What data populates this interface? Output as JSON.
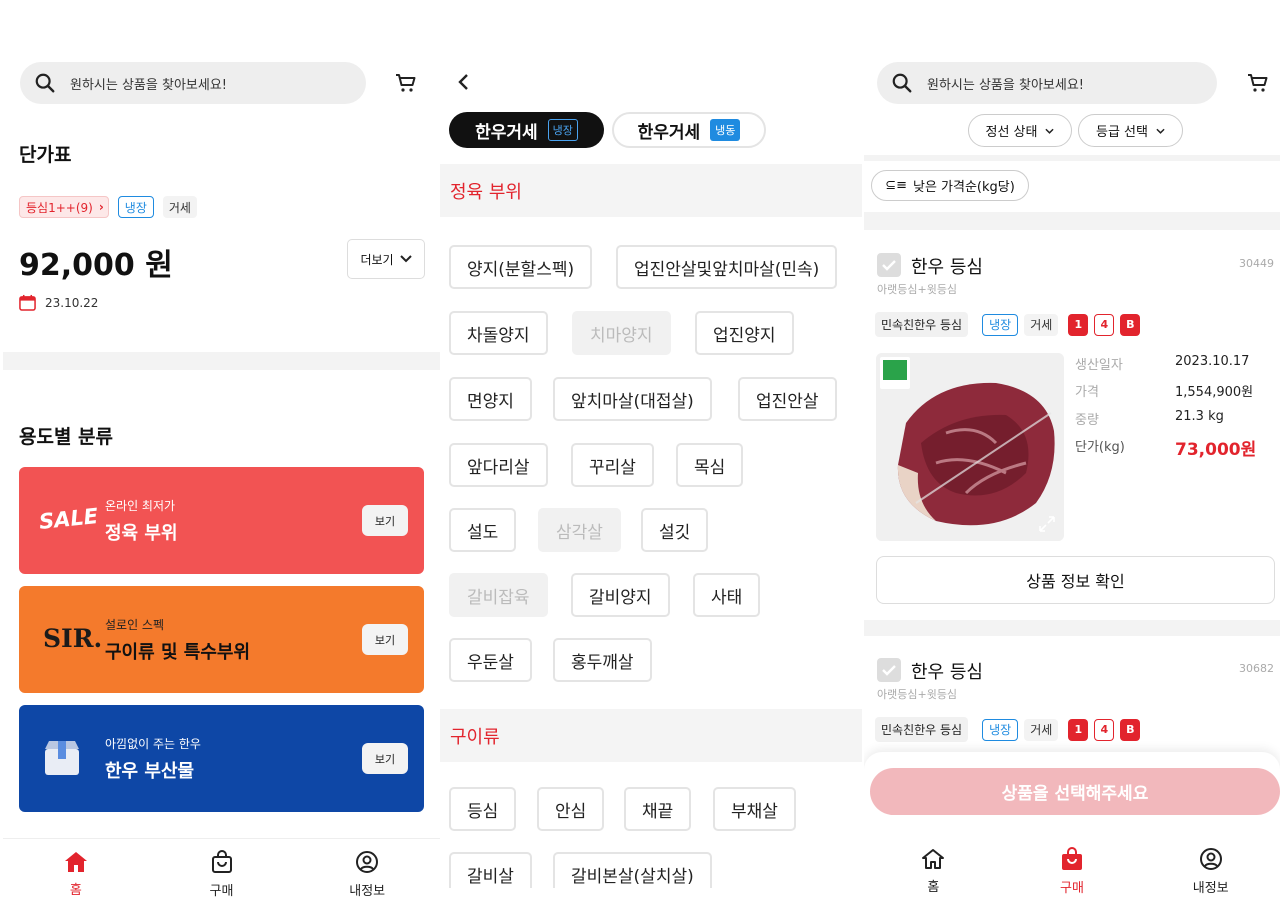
{
  "search": {
    "placeholder": "원하시는 상품을 찾아보세요!"
  },
  "home": {
    "price_table_title": "단가표",
    "chip_grade": "등심1++(9)",
    "chip_storage": "냉장",
    "chip_type": "거세",
    "price": "92,000 원",
    "more_label": "더보기",
    "date": "23.10.22",
    "category_title": "용도별 분류",
    "cards": [
      {
        "badge": "SALE",
        "sub": "온라인 최저가",
        "title": "정육 부위",
        "btn": "보기",
        "color": "#f25353"
      },
      {
        "badge": "SIR.",
        "sub": "설로인 스펙",
        "title": "구이류 및 특수부위",
        "btn": "보기",
        "color": "#f47a2c"
      },
      {
        "badge": "box-icon",
        "sub": "아낌없이 주는 한우",
        "title": "한우 부산물",
        "btn": "보기",
        "color": "#0e47a6"
      }
    ]
  },
  "nav_left": [
    {
      "label": "홈",
      "icon": "home-icon",
      "active": true
    },
    {
      "label": "구매",
      "icon": "shopping-bag-icon",
      "active": false
    },
    {
      "label": "내정보",
      "icon": "user-circle-icon",
      "active": false
    }
  ],
  "catalog": {
    "tabs": [
      {
        "label": "한우거세",
        "badge": "냉장",
        "active": true
      },
      {
        "label": "한우거세",
        "badge": "냉동",
        "active": false
      }
    ],
    "section1": "정육 부위",
    "parts1": [
      {
        "label": "양지(분할스펙)",
        "disabled": false
      },
      {
        "label": "업진안살및앞치마살(민속)",
        "disabled": false
      },
      {
        "label": "차돌양지",
        "disabled": false
      },
      {
        "label": "치마양지",
        "disabled": true
      },
      {
        "label": "업진양지",
        "disabled": false
      },
      {
        "label": "면양지",
        "disabled": false
      },
      {
        "label": "앞치마살(대접살)",
        "disabled": false
      },
      {
        "label": "업진안살",
        "disabled": false
      },
      {
        "label": "앞다리살",
        "disabled": false
      },
      {
        "label": "꾸리살",
        "disabled": false
      },
      {
        "label": "목심",
        "disabled": false
      },
      {
        "label": "설도",
        "disabled": false
      },
      {
        "label": "삼각살",
        "disabled": true
      },
      {
        "label": "설깃",
        "disabled": false
      },
      {
        "label": "갈비잡육",
        "disabled": true
      },
      {
        "label": "갈비양지",
        "disabled": false
      },
      {
        "label": "사태",
        "disabled": false
      },
      {
        "label": "우둔살",
        "disabled": false
      },
      {
        "label": "홍두깨살",
        "disabled": false
      }
    ],
    "section2": "구이류",
    "parts2": [
      {
        "label": "등심",
        "disabled": false
      },
      {
        "label": "안심",
        "disabled": false
      },
      {
        "label": "채끝",
        "disabled": false
      },
      {
        "label": "부채살",
        "disabled": false
      },
      {
        "label": "갈비살",
        "disabled": false
      },
      {
        "label": "갈비본살(살치살)",
        "disabled": false
      }
    ]
  },
  "list": {
    "filter_state": "정선 상태",
    "filter_grade": "등급 선택",
    "sort": "낮은 가격순(kg당)",
    "products": [
      {
        "name": "한우 등심",
        "id": "30449",
        "desc": "아랫등심+윗등심",
        "seller": "민속친한우 등심",
        "storage": "냉장",
        "type": "거세",
        "grades": [
          "1",
          "4",
          "B"
        ],
        "prod_date_label": "생산일자",
        "prod_date": "2023.10.17",
        "price_label": "가격",
        "price": "1,554,900원",
        "weight_label": "중량",
        "weight": "21.3 kg",
        "unit_label": "단가(kg)",
        "unit_price": "73,000원",
        "info_btn": "상품 정보 확인"
      },
      {
        "name": "한우 등심",
        "id": "30682",
        "desc": "아랫등심+윗등심",
        "seller": "민속친한우 등심",
        "storage": "냉장",
        "type": "거세",
        "grades": [
          "1",
          "4",
          "B"
        ]
      }
    ],
    "select_btn": "상품을 선택해주세요"
  },
  "nav_right": [
    {
      "label": "홈",
      "icon": "home-icon",
      "active": false
    },
    {
      "label": "구매",
      "icon": "shopping-bag-icon",
      "active": true
    },
    {
      "label": "내정보",
      "icon": "user-circle-icon",
      "active": false
    }
  ],
  "colors": {
    "accent": "#e2242d",
    "sale": "#f25353",
    "sir": "#f47a2c",
    "byproduct": "#0e47a6",
    "storage": "#1f8be0"
  }
}
